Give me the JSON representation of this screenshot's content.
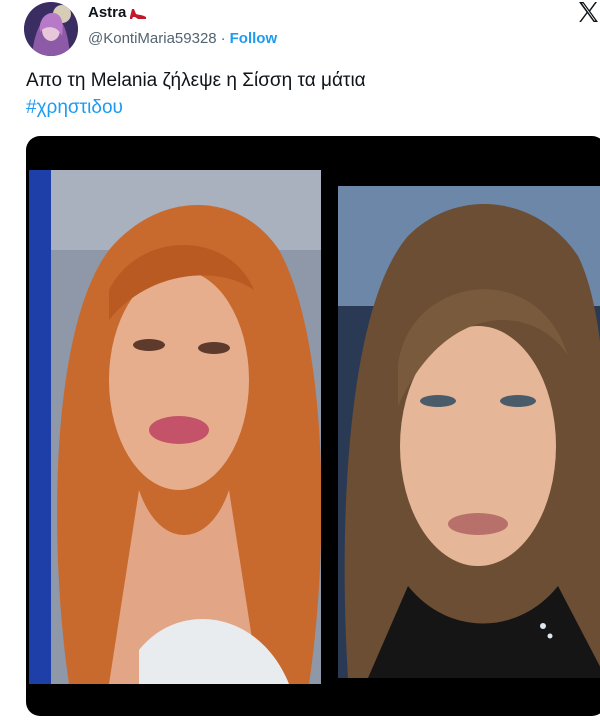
{
  "user": {
    "display_name": "Astra",
    "handle": "@KontiMaria59328",
    "separator": "·",
    "follow_label": "Follow"
  },
  "tweet": {
    "text": "Απο τη Melania ζήλεψε η Σίσση τα μάτια",
    "hashtag": "#χρηστιδου"
  },
  "icons": {
    "emoji_after_name": "high-heel-icon",
    "platform": "x-logo-icon"
  },
  "colors": {
    "link_blue": "#1d9bf0",
    "text_primary": "#0f1419",
    "text_secondary": "#536471",
    "media_background": "#000000"
  }
}
